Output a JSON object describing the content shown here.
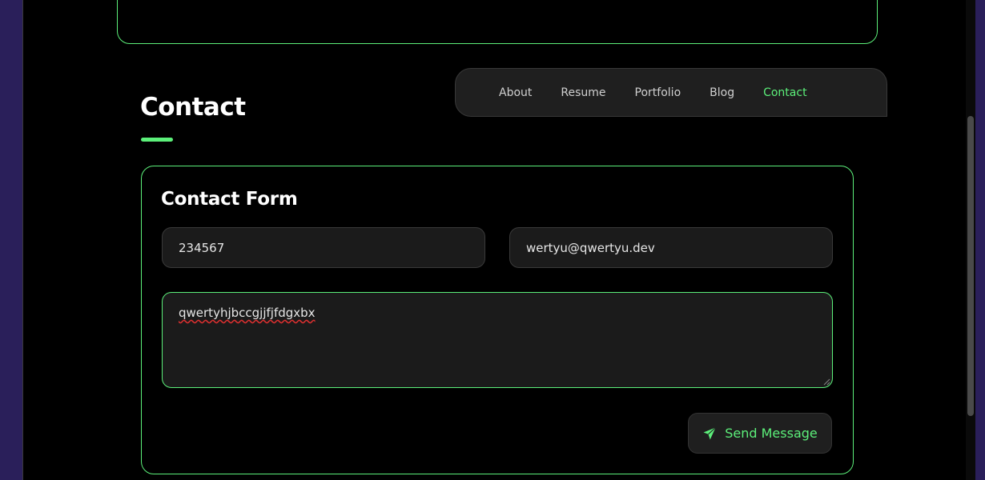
{
  "nav": {
    "items": [
      {
        "label": "About",
        "active": false
      },
      {
        "label": "Resume",
        "active": false
      },
      {
        "label": "Portfolio",
        "active": false
      },
      {
        "label": "Blog",
        "active": false
      },
      {
        "label": "Contact",
        "active": true
      }
    ]
  },
  "page": {
    "title": "Contact"
  },
  "form": {
    "title": "Contact Form",
    "name_value": "234567",
    "email_value": "wertyu@qwertyu.dev",
    "message_value": "qwertyhjbccgjjfjfdgxbx",
    "send_label": "Send Message",
    "send_icon": "paper-plane-icon"
  },
  "colors": {
    "accent": "#5cf07a",
    "background": "#000000",
    "field_bg": "#1b1b1b"
  }
}
